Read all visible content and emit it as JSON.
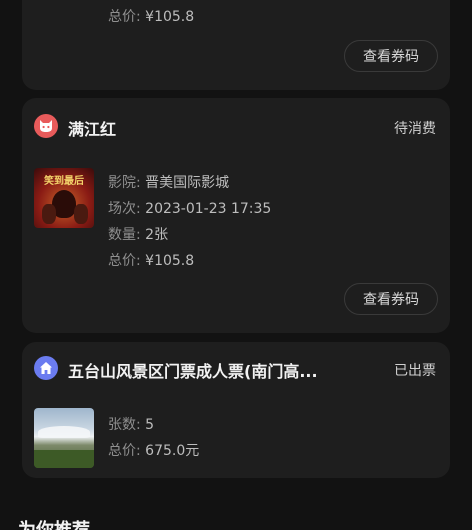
{
  "top_card": {
    "total_label": "总价:",
    "total_value": "¥105.8",
    "button": "查看券码"
  },
  "movie_card": {
    "icon": "cat-face-icon",
    "title": "满江红",
    "status": "待消费",
    "poster_text": "笑到最后",
    "cinema_label": "影院:",
    "cinema_value": "晋美国际影城",
    "session_label": "场次:",
    "session_value": "2023-01-23 17:35",
    "qty_label": "数量:",
    "qty_value": "2张",
    "total_label": "总价:",
    "total_value": "¥105.8",
    "button": "查看券码"
  },
  "scenic_card": {
    "icon": "home-icon",
    "title": "五台山风景区门票成人票(南门高...",
    "status": "已出票",
    "count_label": "张数:",
    "count_value": "5",
    "total_label": "总价:",
    "total_value": "675.0元"
  },
  "recommend": {
    "title": "为你推荐"
  },
  "colors": {
    "background": "#121212",
    "card": "#1e1e1e",
    "movie_icon": "#e85b5b",
    "scenic_icon": "#6b7cf0"
  }
}
